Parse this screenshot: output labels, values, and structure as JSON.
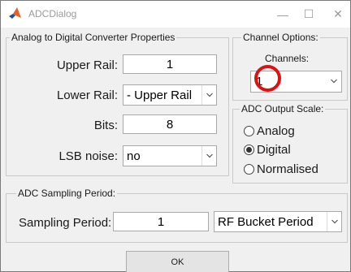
{
  "window": {
    "title": "ADCDialog",
    "app_icon": "matlab-logo-icon",
    "minimize_glyph": "—",
    "maximize_glyph": "☐",
    "close_glyph": "✕"
  },
  "adc_properties": {
    "group_title": "Analog to Digital Converter Properties",
    "upper_rail": {
      "label": "Upper Rail:",
      "value": "1"
    },
    "lower_rail": {
      "label": "Lower Rail:",
      "selected": "- Upper Rail"
    },
    "bits": {
      "label": "Bits:",
      "value": "8"
    },
    "lsb_noise": {
      "label": "LSB noise:",
      "selected": "no"
    }
  },
  "channel_options": {
    "group_title": "Channel Options:",
    "channels_label": "Channels:",
    "channels_selected": "1"
  },
  "output_scale": {
    "group_title": "ADC Output Scale:",
    "options": [
      {
        "label": "Analog",
        "selected": false
      },
      {
        "label": "Digital",
        "selected": true
      },
      {
        "label": "Normalised",
        "selected": false
      }
    ]
  },
  "sampling": {
    "group_title": "ADC Sampling Period:",
    "period_label": "Sampling Period:",
    "period_value": "1",
    "unit_selected": "RF Bucket Period"
  },
  "ok_button": "OK",
  "colors": {
    "window_bg": "#f0f0f0",
    "highlight_ring": "#e01010"
  }
}
